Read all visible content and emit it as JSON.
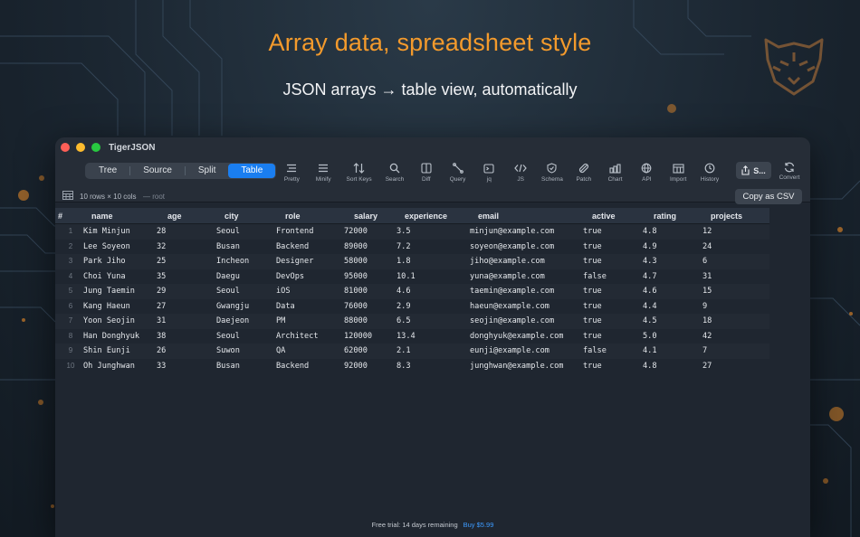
{
  "promo": {
    "headline": "Array data, spreadsheet style",
    "subhead": "JSON arrays → table view, automatically"
  },
  "window": {
    "title": "TigerJSON",
    "view_modes": [
      {
        "label": "Tree",
        "active": false
      },
      {
        "label": "Source",
        "active": false
      },
      {
        "label": "Split",
        "active": false
      },
      {
        "label": "Table",
        "active": true
      }
    ],
    "tools": [
      {
        "label": "Pretty",
        "icon": "pretty-icon"
      },
      {
        "label": "Minify",
        "icon": "minify-icon"
      },
      {
        "label": "Sort Keys",
        "icon": "sort-keys-icon"
      },
      {
        "label": "Search",
        "icon": "search-icon"
      },
      {
        "label": "Diff",
        "icon": "diff-icon"
      },
      {
        "label": "Query",
        "icon": "query-icon"
      },
      {
        "label": "jq",
        "icon": "jq-icon"
      },
      {
        "label": "JS",
        "icon": "js-icon"
      },
      {
        "label": "Schema",
        "icon": "schema-icon"
      },
      {
        "label": "Patch",
        "icon": "patch-icon"
      },
      {
        "label": "Chart",
        "icon": "chart-icon"
      },
      {
        "label": "API",
        "icon": "api-icon"
      },
      {
        "label": "Import",
        "icon": "import-icon"
      },
      {
        "label": "History",
        "icon": "history-icon"
      }
    ],
    "share_label": "S...",
    "convert_label": "Convert"
  },
  "infobar": {
    "row_count": "10 rows × 10 cols",
    "path": "— root",
    "copy_csv": "Copy as CSV"
  },
  "table": {
    "columns": [
      "#",
      "name",
      "age",
      "city",
      "role",
      "salary",
      "experience",
      "email",
      "active",
      "rating",
      "projects"
    ],
    "rows": [
      [
        "1",
        "Kim Minjun",
        "28",
        "Seoul",
        "Frontend",
        "72000",
        "3.5",
        "minjun@example.com",
        "true",
        "4.8",
        "12"
      ],
      [
        "2",
        "Lee Soyeon",
        "32",
        "Busan",
        "Backend",
        "89000",
        "7.2",
        "soyeon@example.com",
        "true",
        "4.9",
        "24"
      ],
      [
        "3",
        "Park Jiho",
        "25",
        "Incheon",
        "Designer",
        "58000",
        "1.8",
        "jiho@example.com",
        "true",
        "4.3",
        "6"
      ],
      [
        "4",
        "Choi Yuna",
        "35",
        "Daegu",
        "DevOps",
        "95000",
        "10.1",
        "yuna@example.com",
        "false",
        "4.7",
        "31"
      ],
      [
        "5",
        "Jung Taemin",
        "29",
        "Seoul",
        "iOS",
        "81000",
        "4.6",
        "taemin@example.com",
        "true",
        "4.6",
        "15"
      ],
      [
        "6",
        "Kang Haeun",
        "27",
        "Gwangju",
        "Data",
        "76000",
        "2.9",
        "haeun@example.com",
        "true",
        "4.4",
        "9"
      ],
      [
        "7",
        "Yoon Seojin",
        "31",
        "Daejeon",
        "PM",
        "88000",
        "6.5",
        "seojin@example.com",
        "true",
        "4.5",
        "18"
      ],
      [
        "8",
        "Han Donghyuk",
        "38",
        "Seoul",
        "Architect",
        "120000",
        "13.4",
        "donghyuk@example.com",
        "true",
        "5.0",
        "42"
      ],
      [
        "9",
        "Shin Eunji",
        "26",
        "Suwon",
        "QA",
        "62000",
        "2.1",
        "eunji@example.com",
        "false",
        "4.1",
        "7"
      ],
      [
        "10",
        "Oh Junghwan",
        "33",
        "Busan",
        "Backend",
        "92000",
        "8.3",
        "junghwan@example.com",
        "true",
        "4.8",
        "27"
      ]
    ]
  },
  "footer": {
    "trial": "Free trial: 14 days remaining",
    "buy": "Buy $5.99"
  },
  "colors": {
    "accent": "#1a7ef0",
    "headline": "#f39a2c",
    "buy_link": "#3d9bff"
  }
}
